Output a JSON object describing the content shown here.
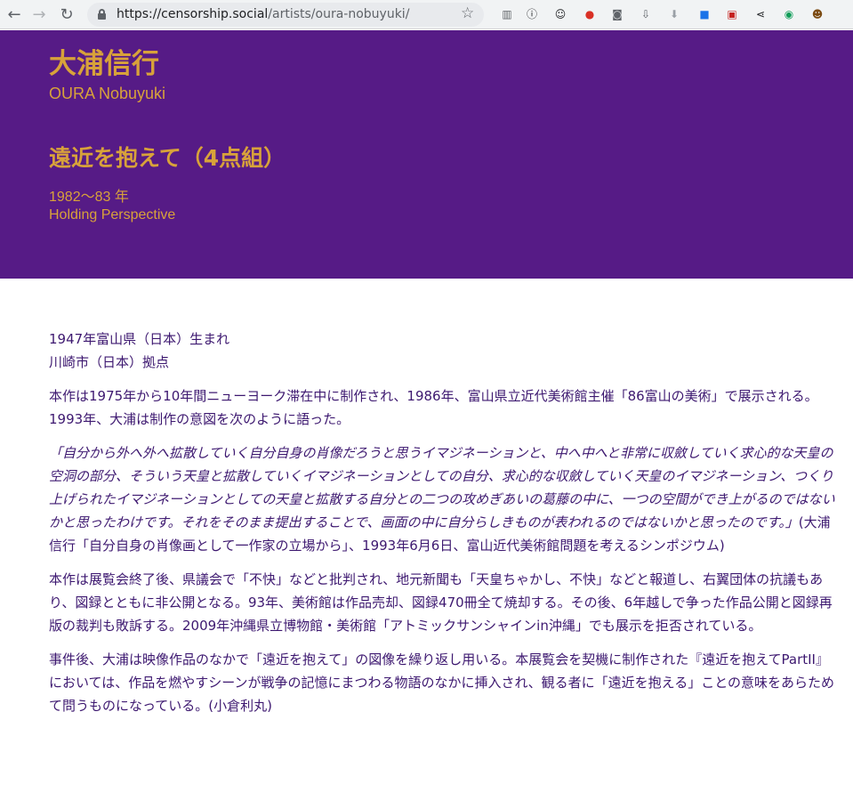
{
  "browser": {
    "url_host": "https://censorship.social",
    "url_path": "/artists/oura-nobuyuki/",
    "nav": {
      "back": "←",
      "forward": "→",
      "reload": "↻"
    },
    "bookmark_icon": "star-icon",
    "extensions": [
      {
        "name": "reading-list-icon",
        "glyph": "▥",
        "color": "#5f6368"
      },
      {
        "name": "alert-circle-icon",
        "glyph": "ⓘ",
        "color": "#202124"
      },
      {
        "name": "smiley-icon",
        "glyph": "☺",
        "color": "#202124"
      },
      {
        "name": "record-icon",
        "glyph": "●",
        "color": "#d93025"
      },
      {
        "name": "camera-icon",
        "glyph": "◙",
        "color": "#5f6368"
      },
      {
        "name": "download-box-icon",
        "glyph": "⇩",
        "color": "#5f6368"
      },
      {
        "name": "download-arrow-icon",
        "glyph": "⬇",
        "color": "#9aa0a6"
      },
      {
        "name": "blue-badge-icon",
        "glyph": "■",
        "color": "#1a73e8"
      },
      {
        "name": "pdf-icon",
        "glyph": "▣",
        "color": "#c5221f"
      },
      {
        "name": "share-icon",
        "glyph": "⋖",
        "color": "#202124"
      },
      {
        "name": "green-share-icon",
        "glyph": "◉",
        "color": "#0f9d58"
      },
      {
        "name": "avatar-extension-icon",
        "glyph": "☻",
        "color": "#7b4a12"
      }
    ]
  },
  "colors": {
    "hero_bg": "#561b86",
    "hero_text": "#d8a23a",
    "body_text": "#3d1870"
  },
  "artist": {
    "name_ja": "大浦信行",
    "name_en": "OURA Nobuyuki",
    "work_title_ja": "遠近を抱えて（4点組）",
    "year": "1982〜83 年",
    "work_title_en": "Holding Perspective"
  },
  "bio": {
    "born": "1947年富山県（日本）生まれ",
    "based": "川崎市（日本）拠点"
  },
  "paragraphs": {
    "intro": "本作は1975年から10年間ニューヨーク滞在中に制作され、1986年、富山県立近代美術館主催「86富山の美術」で展示される。1993年、大浦は制作の意図を次のように語った。",
    "quote": "「自分から外へ外へ拡散していく自分自身の肖像だろうと思うイマジネーションと、中へ中へと非常に収斂していく求心的な天皇の空洞の部分、そういう天皇と拡散していくイマジネーションとしての自分、求心的な収斂していく天皇のイマジネーション、つくり上げられたイマジネーションとしての天皇と拡散する自分との二つの攻めぎあいの葛藤の中に、一つの空間ができ上がるのではないかと思ったわけです。それをそのまま提出することで、画面の中に自分らしきものが表われるのではないかと思ったのです。」",
    "quote_cite": "(大浦信行「自分自身の肖像画として一作家の立場から」、1993年6月6日、富山近代美術館問題を考えるシンポジウム)",
    "history": "本作は展覧会終了後、県議会で「不快」などと批判され、地元新聞も「天皇ちゃかし、不快」などと報道し、右翼団体の抗議もあり、図録とともに非公開となる。93年、美術館は作品売却、図録470冊全て焼却する。その後、6年越しで争った作品公開と図録再版の裁判も敗訴する。2009年沖縄県立博物館・美術館「アトミックサンシャインin沖縄」でも展示を拒否されている。",
    "aftermath": "事件後、大浦は映像作品のなかで「遠近を抱えて」の図像を繰り返し用いる。本展覧会を契機に制作された『遠近を抱えてPartII』においては、作品を燃やすシーンが戦争の記憶にまつわる物語のなかに挿入され、観る者に「遠近を抱える」ことの意味をあらためて問うものになっている。(小倉利丸)"
  }
}
